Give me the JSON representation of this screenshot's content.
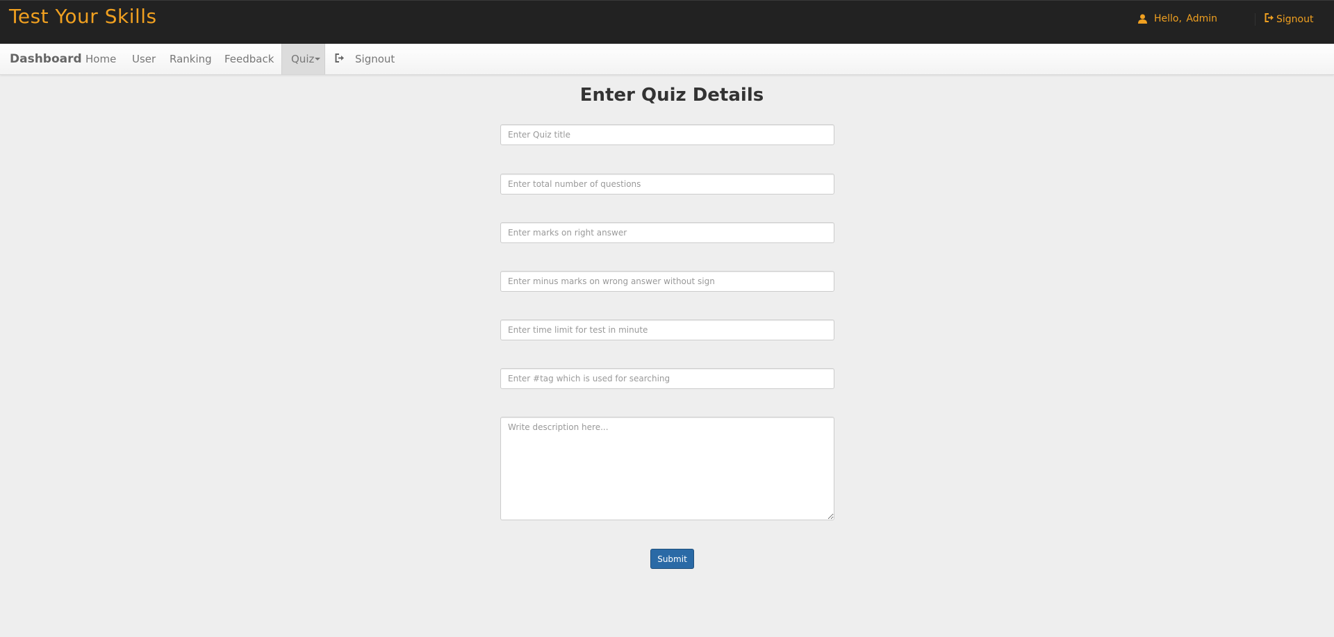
{
  "header": {
    "brand": "Test Your Skills",
    "greeting": "Hello,",
    "user_name": "Admin",
    "signout": "Signout"
  },
  "navbar": {
    "brand": "Dashboard",
    "items": [
      {
        "label": "Home"
      },
      {
        "label": "User"
      },
      {
        "label": "Ranking"
      },
      {
        "label": "Feedback"
      },
      {
        "label": "Quiz",
        "active": true,
        "dropdown": true
      },
      {
        "label": "Signout"
      }
    ]
  },
  "form": {
    "title": "Enter Quiz Details",
    "fields": [
      {
        "placeholder": "Enter Quiz title",
        "value": ""
      },
      {
        "placeholder": "Enter total number of questions",
        "value": ""
      },
      {
        "placeholder": "Enter marks on right answer",
        "value": ""
      },
      {
        "placeholder": "Enter minus marks on wrong answer without sign",
        "value": ""
      },
      {
        "placeholder": "Enter time limit for test in minute",
        "value": ""
      },
      {
        "placeholder": "Enter #tag which is used for searching",
        "value": ""
      }
    ],
    "description_placeholder": "Write description here...",
    "submit_label": "Submit"
  },
  "colors": {
    "accent": "#f0a020",
    "header_bg": "#222222",
    "page_bg": "#eeeeee",
    "submit_bg": "#2a6aa6"
  },
  "icons": {
    "user": "user-icon",
    "signout": "signout-icon"
  }
}
